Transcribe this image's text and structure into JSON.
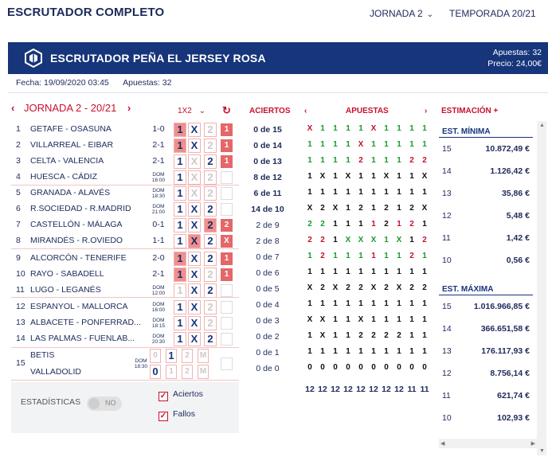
{
  "header": {
    "app_title": "ESCRUTADOR COMPLETO",
    "jornada_select": "JORNADA 2",
    "temporada_select": "TEMPORADA 20/21"
  },
  "banner": {
    "title": "ESCRUTADOR PEÑA EL JERSEY ROSA",
    "apuestas": "Apuestas: 32",
    "precio": "Precio: 24,00€"
  },
  "info": {
    "fecha": "Fecha: 19/09/2020 03:45",
    "apuestas": "Apuestas: 32"
  },
  "nav": {
    "jornada_title": "JORNADA 2 - 20/21",
    "col_1x2": "1X2",
    "col_aciertos": "ACIERTOS",
    "col_apuestas": "APUESTAS",
    "col_estimacion": "ESTIMACIÓN +"
  },
  "matches": [
    {
      "num": "1",
      "name": "GETAFE - OSASUNA",
      "res": "1-0"
    },
    {
      "num": "2",
      "name": "VILLARREAL - EIBAR",
      "res": "2-1"
    },
    {
      "num": "3",
      "name": "CELTA - VALENCIA",
      "res": "2-1"
    },
    {
      "num": "4",
      "name": "HUESCA - CÁDIZ",
      "res": "DOM 16:00"
    },
    {
      "num": "5",
      "name": "GRANADA - ALAVÉS",
      "res": "DOM 18:30"
    },
    {
      "num": "6",
      "name": "R.SOCIEDAD - R.MADRID",
      "res": "DOM 21:00"
    },
    {
      "num": "7",
      "name": "CASTELLÓN - MÁLAGA",
      "res": "0-1"
    },
    {
      "num": "8",
      "name": "MIRANDÉS - R.OVIEDO",
      "res": "1-1"
    },
    {
      "num": "9",
      "name": "ALCORCÓN - TENERIFE",
      "res": "2-0"
    },
    {
      "num": "10",
      "name": "RAYO - SABADELL",
      "res": "2-1"
    },
    {
      "num": "11",
      "name": "LUGO - LEGANÉS",
      "res": "DOM 12:00"
    },
    {
      "num": "12",
      "name": "ESPANYOL - MALLORCA",
      "res": "DOM 16:00"
    },
    {
      "num": "13",
      "name": "ALBACETE - PONFERRAD...",
      "res": "DOM 18:15"
    },
    {
      "num": "14",
      "name": "LAS PALMAS - FUENLAB...",
      "res": "DOM 20:30"
    }
  ],
  "m15": {
    "num": "15",
    "home": "BETIS",
    "away": "VALLADOLID",
    "res": "DOM 18:30"
  },
  "aciertos": [
    "0 de 15",
    "0 de 14",
    "0 de 13",
    "8 de 12",
    "6 de 11",
    "14 de 10",
    "2 de 9",
    "2 de 8",
    "0 de 7",
    "0 de 6",
    "0 de 5",
    "0 de 4",
    "0 de 3",
    "0 de 2",
    "0 de 1",
    "0 de 0"
  ],
  "apuestas_rows": [
    "X1111X1111",
    "1111X11111",
    "1111211122",
    "1X1X11X11X",
    "1111111111",
    "X2X12121 2X",
    "2211112121",
    "221XXX1X12",
    "1211111121",
    "1111111111",
    "X2X22X2X22",
    "1111111111",
    "XX11X11111",
    "1X11222211",
    "1111111111",
    "0000000000"
  ],
  "totales": [
    "12",
    "12",
    "12",
    "12",
    "12",
    "12",
    "12",
    "12",
    "11",
    "11"
  ],
  "est_min": {
    "title": "EST. MÍNIMA",
    "rows": [
      {
        "level": "15",
        "value": "10.872,49 €"
      },
      {
        "level": "14",
        "value": "1.126,42 €"
      },
      {
        "level": "13",
        "value": "35,86 €"
      },
      {
        "level": "12",
        "value": "5,48 €"
      },
      {
        "level": "11",
        "value": "1,42 €"
      },
      {
        "level": "10",
        "value": "0,56 €"
      }
    ]
  },
  "est_max": {
    "title": "EST. MÁXIMA",
    "rows": [
      {
        "level": "15",
        "value": "1.016.966,85 €"
      },
      {
        "level": "14",
        "value": "366.651,58 €"
      },
      {
        "level": "13",
        "value": "176.117,93 €"
      },
      {
        "level": "12",
        "value": "8.756,14 €"
      },
      {
        "level": "11",
        "value": "621,74 €"
      },
      {
        "level": "10",
        "value": "102,93 €"
      }
    ]
  },
  "stats": {
    "label": "ESTADÍSTICAS",
    "toggle": "NO",
    "aciertos": "Aciertos",
    "fallos": "Fallos"
  },
  "colors": {
    "navy": "#16357a",
    "red": "#c8102e",
    "hit": "#f08f8f",
    "green": "#1a9a2a"
  }
}
